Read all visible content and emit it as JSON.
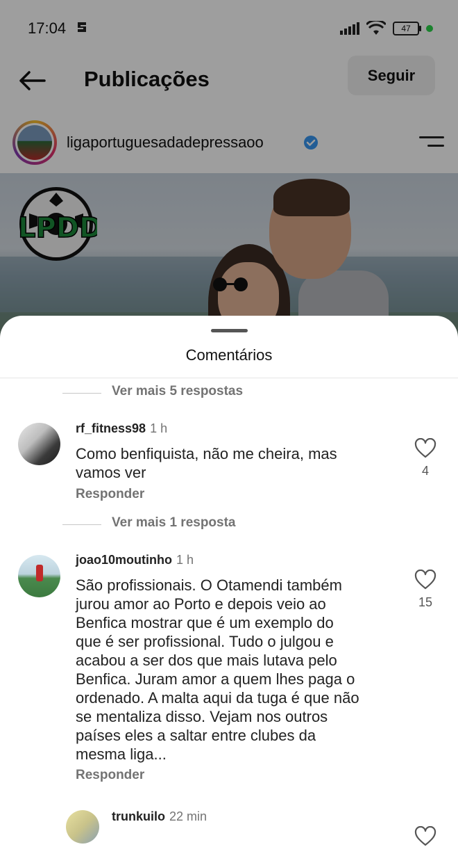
{
  "status_bar": {
    "time": "17:04",
    "battery": "47"
  },
  "header": {
    "title": "Publicações",
    "follow_label": "Seguir"
  },
  "post": {
    "username": "ligaportuguesadadepressaoo",
    "logo_text": "LPDD"
  },
  "sheet": {
    "title": "Comentários"
  },
  "comments": [
    {
      "more_replies": "Ver mais 5 respostas"
    },
    {
      "username": "rf_fitness98",
      "time": "1 h",
      "text": "Como benfiquista, não me cheira, mas\nvamos ver",
      "reply_label": "Responder",
      "likes": "4"
    },
    {
      "more_replies": "Ver mais 1 resposta"
    },
    {
      "username": "joao10moutinho",
      "time": "1 h",
      "text": "São profissionais. O Otamendi também\njurou amor ao Porto e depois veio ao\nBenfica mostrar que é um exemplo do\nque é ser profissional. Tudo o julgou e\nacabou a ser dos que mais lutava pelo\nBenfica. Juram amor a quem lhes paga o\nordenado. A malta aqui da tuga é que não\nse mentaliza disso. Vejam nos outros\npaíses eles a saltar entre clubes da\nmesma liga...",
      "reply_label": "Responder",
      "likes": "15"
    },
    {
      "username": "trunkuilo",
      "time": "22 min"
    }
  ],
  "colors": {
    "verified": "#3897f0",
    "status_dot": "#2bd24a",
    "sheet_bg": "#ffffff"
  }
}
